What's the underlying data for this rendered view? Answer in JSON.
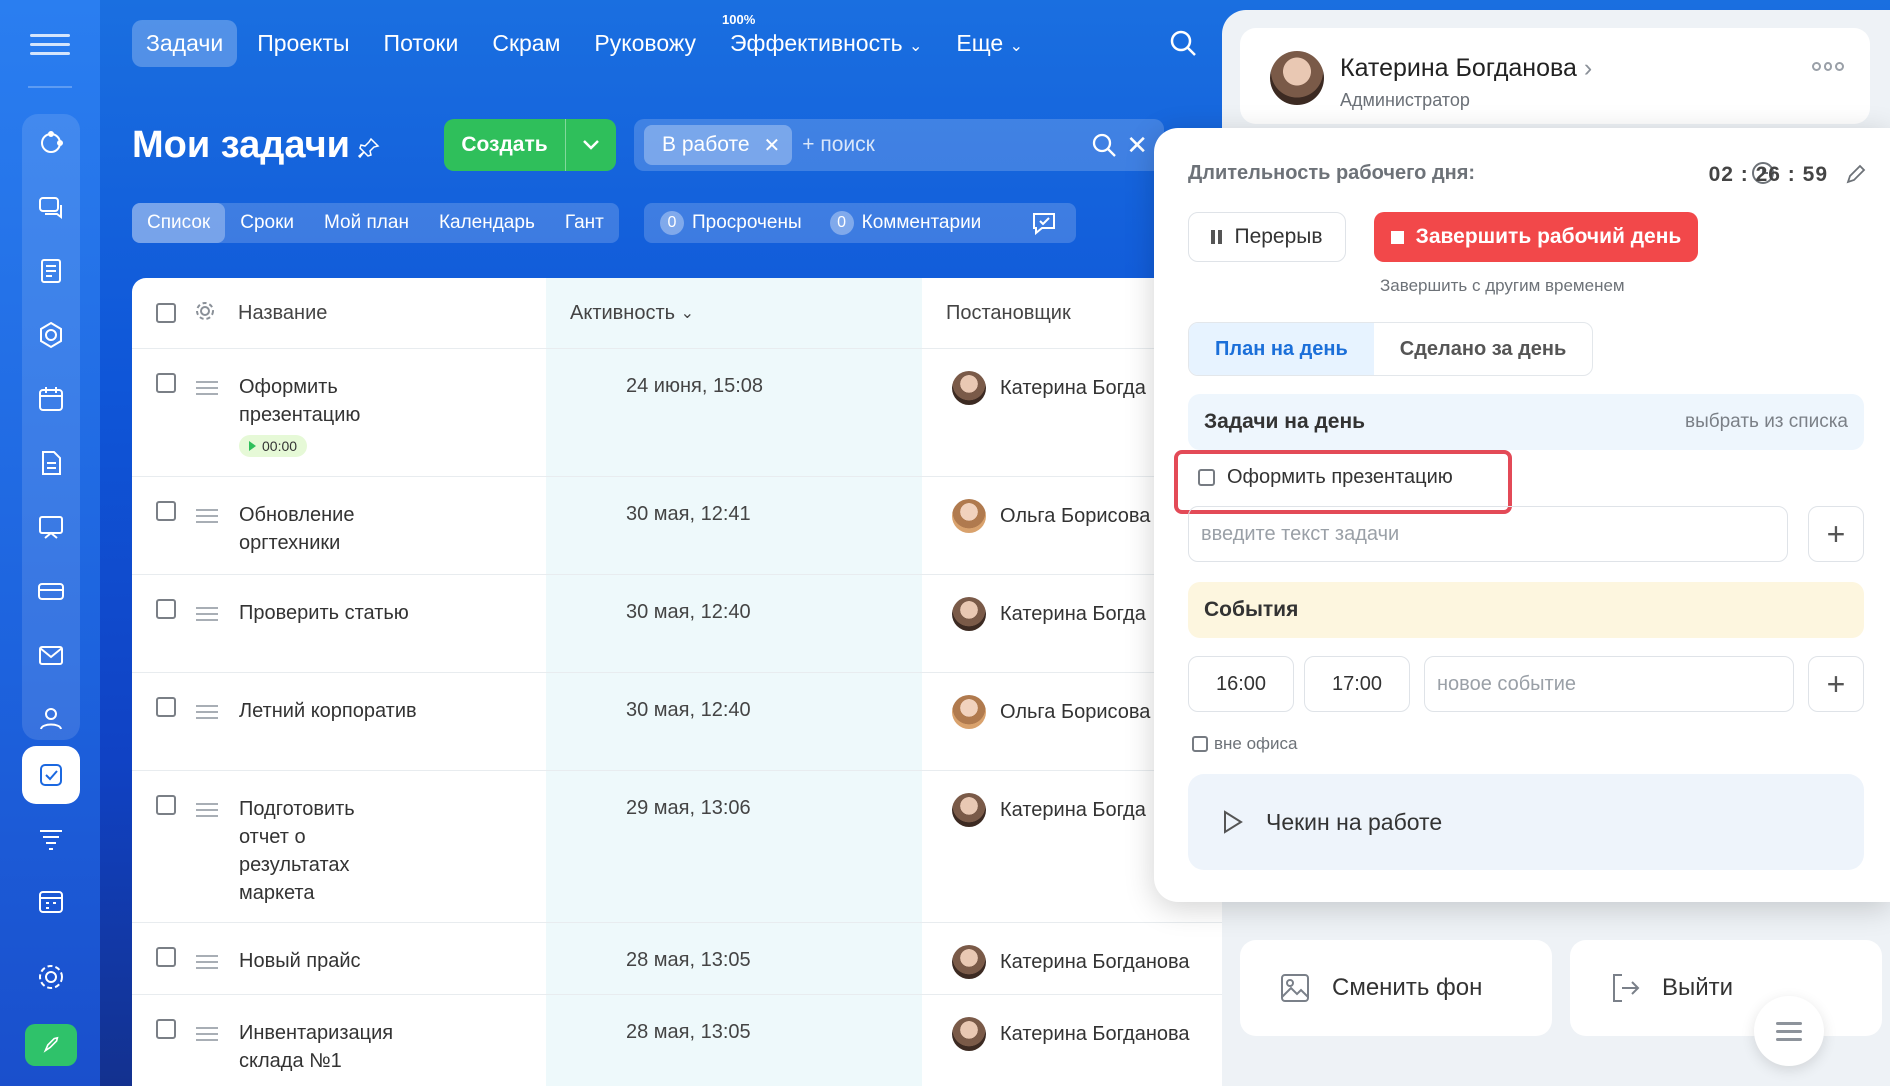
{
  "nav": {
    "items": [
      "Задачи",
      "Проекты",
      "Потоки",
      "Скрам",
      "Руковожу",
      "Эффективность",
      "Еще"
    ],
    "efficiency_badge": "100%"
  },
  "page": {
    "title": "Мои задачи",
    "create_label": "Создать",
    "filter_chip": "В работе",
    "search_placeholder": "+ поиск"
  },
  "views": [
    "Список",
    "Сроки",
    "Мой план",
    "Календарь",
    "Гант"
  ],
  "counters": {
    "overdue_count": "0",
    "overdue_label": "Просрочены",
    "comments_count": "0",
    "comments_label": "Комментарии"
  },
  "table": {
    "headers": {
      "name": "Название",
      "activity": "Активность",
      "creator": "Постановщик"
    },
    "timer": "00:00",
    "rows": [
      {
        "name": "Оформить презентацию",
        "activity": "24 июня, 15:08",
        "creator": "Катерина Богда"
      },
      {
        "name": "Обновление оргтехники",
        "activity": "30 мая, 12:41",
        "creator": "Ольга Борисова"
      },
      {
        "name": "Проверить статью",
        "activity": "30 мая, 12:40",
        "creator": "Катерина Богда"
      },
      {
        "name": "Летний корпоратив",
        "activity": "30 мая, 12:40",
        "creator": "Ольга Борисова"
      },
      {
        "name": "Подготовить отчет о результатах маркета",
        "activity": "29 мая, 13:06",
        "creator": "Катерина Богда"
      },
      {
        "name": "Новый прайс",
        "activity": "28 мая, 13:05",
        "creator": "Катерина Богданова"
      },
      {
        "name": "Инвентаризация склада №1",
        "activity": "28 мая, 13:05",
        "creator": "Катерина Богданова"
      }
    ]
  },
  "profile": {
    "name": "Катерина Богданова",
    "role": "Администратор",
    "change_bg": "Сменить фон",
    "logout": "Выйти"
  },
  "workday": {
    "title": "Длительность рабочего дня:",
    "time": "02 : 26 : 59",
    "pause": "Перерыв",
    "end_day": "Завершить рабочий день",
    "end_other": "Завершить с другим временем",
    "tab_plan": "План на день",
    "tab_done": "Сделано за день",
    "tasks_title": "Задачи на день",
    "tasks_link": "выбрать из списка",
    "task_item": "Оформить презентацию",
    "task_placeholder": "введите текст задачи",
    "events_title": "События",
    "event_from": "16:00",
    "event_to": "17:00",
    "event_placeholder": "новое событие",
    "offsite": "вне офиса",
    "checkin": "Чекин на работе"
  },
  "colors": {
    "accent_blue": "#1b68e0",
    "create_green": "#2fbf5b",
    "end_red": "#f2484a",
    "highlight_red": "#e34a57",
    "events_bg": "#fdf6df"
  }
}
